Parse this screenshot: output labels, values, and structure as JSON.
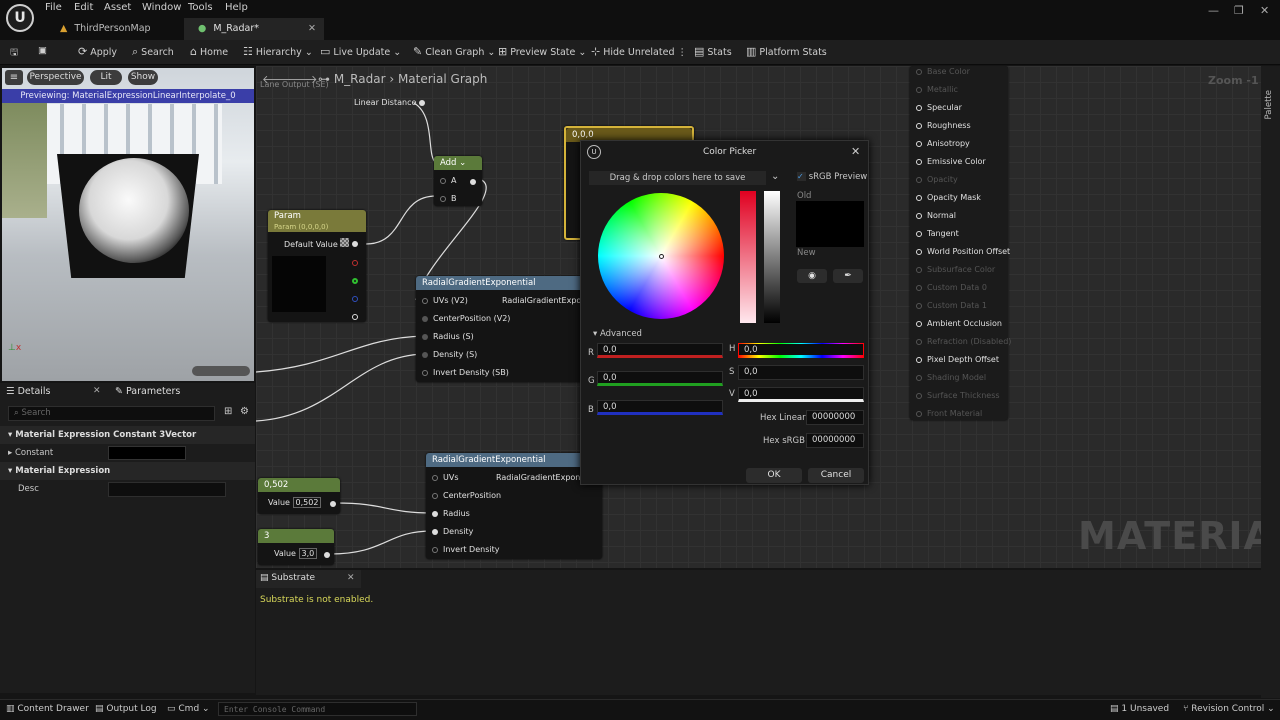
{
  "menu": [
    "File",
    "Edit",
    "Asset",
    "Window",
    "Tools",
    "Help"
  ],
  "tabs": [
    {
      "label": "ThirdPersonMap"
    },
    {
      "label": "M_Radar*"
    }
  ],
  "window_controls": [
    "—",
    "❐",
    "✕"
  ],
  "toolbar": {
    "apply": "Apply",
    "search": "Search",
    "home": "Home",
    "hierarchy": "Hierarchy",
    "live_update": "Live Update",
    "clean_graph": "Clean Graph",
    "preview_state": "Preview State",
    "hide_unrelated": "Hide Unrelated",
    "stats": "Stats",
    "platform_stats": "Platform Stats"
  },
  "viewport": {
    "perspective": "Perspective",
    "lit": "Lit",
    "show": "Show",
    "previewing": "Previewing: MaterialExpressionLinearInterpolate_0"
  },
  "details": {
    "tab_details": "Details",
    "tab_parameters": "Parameters",
    "search_placeholder": "Search",
    "section1": "Material Expression Constant 3Vector",
    "constant": "Constant",
    "section2": "Material Expression",
    "desc": "Desc"
  },
  "graph": {
    "breadcrumb_root": "M_Radar",
    "breadcrumb_child": "Material Graph",
    "zoom": "Zoom -1",
    "linear_distance": "Linear Distance",
    "top_frag": "Lane Output (SE)",
    "add": {
      "title": "Add",
      "a": "A",
      "b": "B"
    },
    "param": {
      "title": "Param",
      "subtitle": "Param (0,0,0,0)",
      "default": "Default Value"
    },
    "const_node": "0,0,0",
    "rge1": {
      "title": "RadialGradientExponential",
      "out": "RadialGradientExponential",
      "pins": [
        "UVs (V2)",
        "CenterPosition (V2)",
        "Radius (S)",
        "Density (S)",
        "Invert Density (SB)"
      ]
    },
    "rge2": {
      "title": "RadialGradientExponential",
      "out": "RadialGradientExponential",
      "pins": [
        "UVs",
        "CenterPosition",
        "Radius",
        "Density",
        "Invert Density"
      ]
    },
    "c1": {
      "title": "0,502",
      "label": "Value",
      "value": "0,502"
    },
    "c2": {
      "title": "3",
      "label": "Value",
      "value": "3,0"
    },
    "result_pins": [
      "Base Color",
      "Metallic",
      "Specular",
      "Roughness",
      "Anisotropy",
      "Emissive Color",
      "Opacity",
      "Opacity Mask",
      "Normal",
      "Tangent",
      "World Position Offset",
      "Subsurface Color",
      "Custom Data 0",
      "Custom Data 1",
      "Ambient Occlusion",
      "Refraction (Disabled)",
      "Pixel Depth Offset",
      "Shading Model",
      "Surface Thickness",
      "Front Material"
    ],
    "result_enabled": [
      false,
      false,
      true,
      true,
      true,
      true,
      false,
      true,
      true,
      true,
      true,
      false,
      false,
      false,
      true,
      false,
      true,
      false,
      false,
      false
    ],
    "watermark": "MATERIAL",
    "palette": "Palette"
  },
  "picker": {
    "title": "Color Picker",
    "dragdrop": "Drag & drop colors here to save",
    "srgb": "sRGB Preview",
    "old": "Old",
    "new": "New",
    "advanced": "Advanced",
    "r": "R",
    "g": "G",
    "b": "B",
    "h": "H",
    "s": "S",
    "v": "V",
    "r_val": "0,0",
    "g_val": "0,0",
    "b_val": "0,0",
    "h_val": "0,0",
    "s_val": "0,0",
    "v_val": "0,0",
    "hex_linear_label": "Hex Linear",
    "hex_linear": "00000000",
    "hex_srgb_label": "Hex sRGB",
    "hex_srgb": "00000000",
    "ok": "OK",
    "cancel": "Cancel"
  },
  "substrate": {
    "title": "Substrate",
    "message": "Substrate is not enabled."
  },
  "status": {
    "content_drawer": "Content Drawer",
    "output_log": "Output Log",
    "cmd": "Cmd",
    "console_placeholder": "Enter Console Command",
    "unsaved": "1 Unsaved",
    "revision": "Revision Control"
  },
  "colors": {
    "accent_yellow": "#d4b33a",
    "node_green": "#5b7a3a",
    "node_blue": "#4e6a82",
    "banner": "#3a3ea8",
    "text_yellow": "#d8d85a"
  }
}
